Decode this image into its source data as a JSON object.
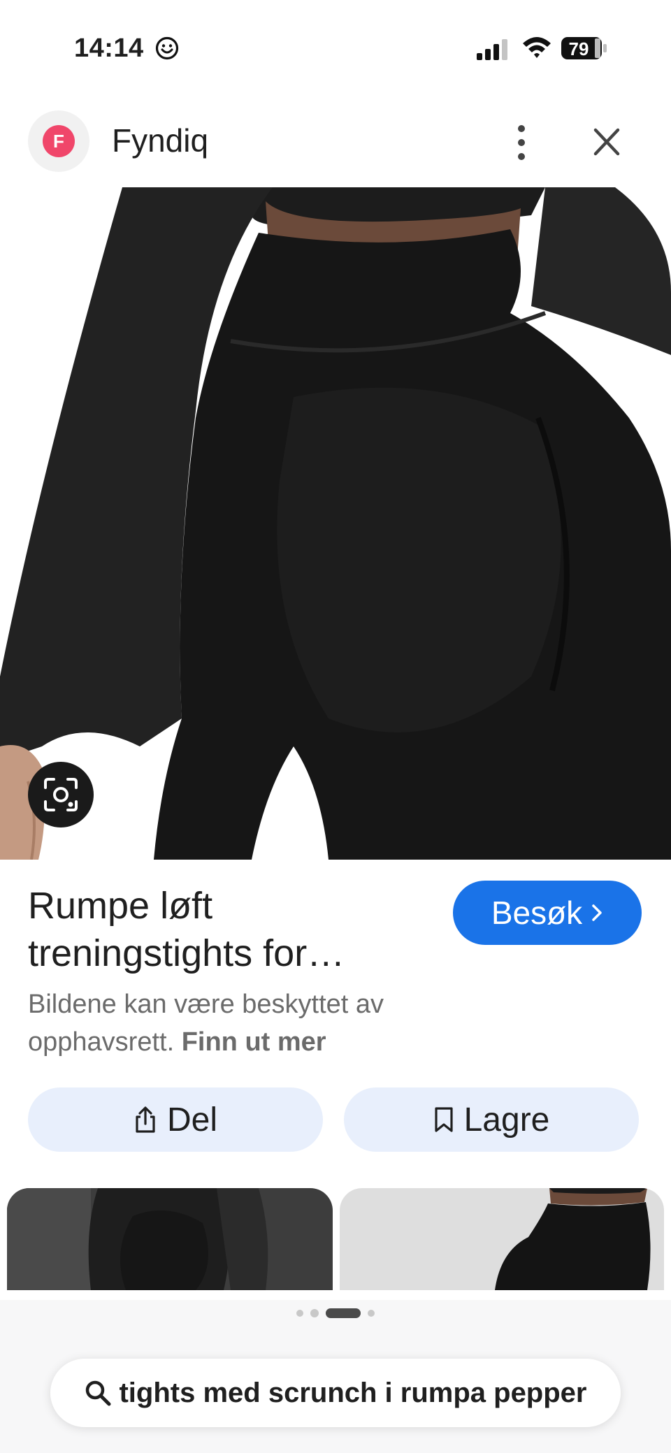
{
  "status_bar": {
    "time": "14:14",
    "battery_level": "79"
  },
  "header": {
    "site_logo_letter": "F",
    "site_name": "Fyndiq"
  },
  "result": {
    "title": "Rumpe løft treningstights for…",
    "visit_label": "Besøk",
    "copyright_text": "Bildene kan være beskyttet av opphavsrett.",
    "learn_more_label": "Finn ut mer"
  },
  "actions": {
    "share_label": "Del",
    "save_label": "Lagre"
  },
  "pager": {
    "total": 4,
    "active_index": 2
  },
  "search": {
    "query": "tights med scrunch i rumpa pepper"
  },
  "colors": {
    "accent": "#1a73e8",
    "chip_background": "#e8effc",
    "logo": "#f0466a"
  }
}
